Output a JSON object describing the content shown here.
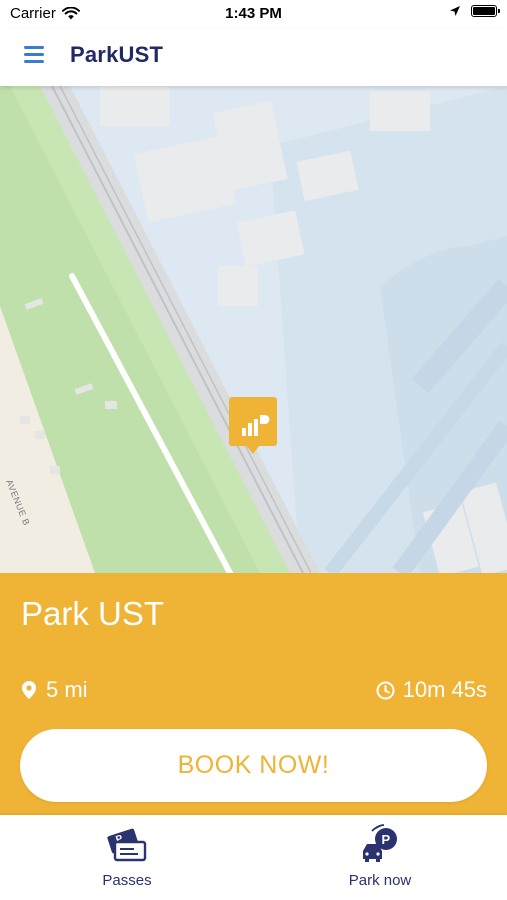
{
  "status_bar": {
    "carrier": "Carrier",
    "time": "1:43 PM"
  },
  "header": {
    "title": "ParkUST",
    "menu_icon": "hamburger-menu-icon"
  },
  "map": {
    "street_label": "AVENUE B",
    "pin_icon": "parking-logo-icon"
  },
  "card": {
    "name": "Park UST",
    "distance": "5 mi",
    "time_remaining": "10m 45s",
    "book_label": "BOOK NOW!",
    "accent_color": "#efb335"
  },
  "tabs": [
    {
      "label": "Passes",
      "icon": "parking-passes-icon"
    },
    {
      "label": "Park now",
      "icon": "park-now-car-icon"
    }
  ],
  "colors": {
    "brand_navy": "#222a66",
    "menu_blue": "#3b7bd6",
    "card_yellow": "#efb335"
  }
}
